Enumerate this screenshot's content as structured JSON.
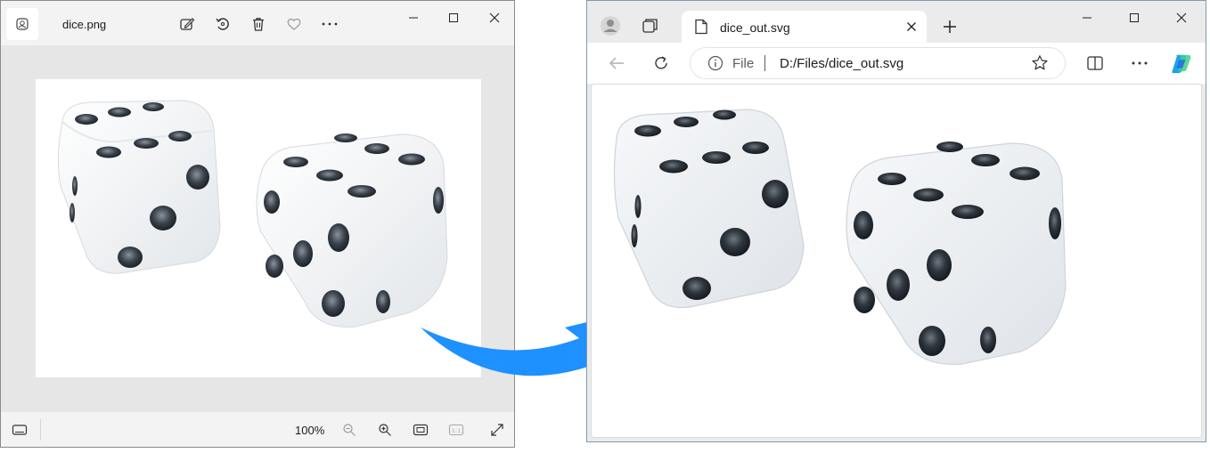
{
  "photos_viewer": {
    "filename": "dice.png",
    "zoom_level": "100%",
    "toolbar_icons": [
      "photo-app-icon",
      "edit-image-icon",
      "rotate-icon",
      "delete-icon",
      "favorite-heart-icon",
      "more-icon"
    ],
    "window_controls": [
      "minimize-icon",
      "maximize-icon",
      "close-icon"
    ],
    "bottom_icons": [
      "filmstrip-icon",
      "zoom-out-icon",
      "zoom-in-icon",
      "fit-to-window-icon",
      "actual-size-icon",
      "fullscreen-icon"
    ]
  },
  "browser": {
    "tab_title": "dice_out.svg",
    "address_scheme": "File",
    "address_url": "D:/Files/dice_out.svg",
    "toolbar_icons": [
      "back-icon",
      "refresh-icon",
      "info-icon",
      "favorite-star-icon",
      "split-screen-icon",
      "more-icon",
      "copilot-icon"
    ],
    "window_controls": [
      "minimize-icon",
      "maximize-icon",
      "close-icon"
    ]
  },
  "colors": {
    "arrow": "#1e90ff",
    "die_face": "#eef1f4",
    "pip": "#2b3138",
    "copilot_blue": "#1aa3e8",
    "copilot_green": "#3ecf8e"
  }
}
